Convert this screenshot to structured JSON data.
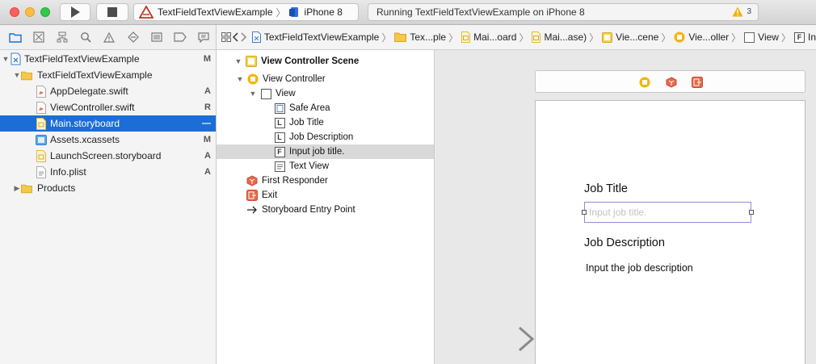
{
  "toolbar": {
    "scheme_project": "TextFieldTextViewExample",
    "scheme_device": "iPhone 8",
    "activity_status": "Running TextFieldTextViewExample on iPhone 8",
    "warning_count": "3"
  },
  "navigator": {
    "tabs": [
      "folder-icon",
      "source-control-icon",
      "hierarchy-icon",
      "search-icon",
      "warning-icon",
      "test-icon",
      "debug-icon",
      "breakpoint-icon",
      "report-icon"
    ],
    "items": [
      {
        "label": "TextFieldTextViewExample",
        "status": "M",
        "icon": "project-icon",
        "depth": 0,
        "expanded": true
      },
      {
        "label": "TextFieldTextViewExample",
        "status": "",
        "icon": "folder-icon",
        "depth": 1,
        "expanded": true
      },
      {
        "label": "AppDelegate.swift",
        "status": "A",
        "icon": "swift-file-icon",
        "depth": 2
      },
      {
        "label": "ViewController.swift",
        "status": "R",
        "icon": "swift-file-icon",
        "depth": 2
      },
      {
        "label": "Main.storyboard",
        "status": "—",
        "icon": "storyboard-icon",
        "depth": 2,
        "selected": true
      },
      {
        "label": "Assets.xcassets",
        "status": "M",
        "icon": "assets-icon",
        "depth": 2
      },
      {
        "label": "LaunchScreen.storyboard",
        "status": "A",
        "icon": "storyboard-icon",
        "depth": 2
      },
      {
        "label": "Info.plist",
        "status": "A",
        "icon": "plist-icon",
        "depth": 2
      },
      {
        "label": "Products",
        "status": "",
        "icon": "folder-icon",
        "depth": 1,
        "expanded": false
      }
    ]
  },
  "jumpbar": {
    "crumbs": [
      "TextFieldTextViewExample",
      "Tex...ple",
      "Mai...oard",
      "Mai...ase)",
      "Vie...cene",
      "Vie...oller",
      "View",
      "In"
    ]
  },
  "outline": {
    "items": [
      {
        "label": "View Controller Scene",
        "icon": "scene-icon",
        "bold": true
      },
      {
        "label": "View Controller",
        "icon": "view-controller-icon"
      },
      {
        "label": "View",
        "icon": "view-icon"
      },
      {
        "label": "Safe Area",
        "icon": "safe-area-icon"
      },
      {
        "label": "Job Title",
        "icon": "label-icon",
        "glyph": "L"
      },
      {
        "label": "Job Description",
        "icon": "label-icon",
        "glyph": "L"
      },
      {
        "label": "Input job title.",
        "icon": "text-field-icon",
        "glyph": "F",
        "selected": true
      },
      {
        "label": "Text View",
        "icon": "text-view-icon"
      },
      {
        "label": "First Responder",
        "icon": "first-responder-icon"
      },
      {
        "label": "Exit",
        "icon": "exit-icon"
      },
      {
        "label": "Storyboard Entry Point",
        "icon": "entry-point-icon"
      }
    ]
  },
  "canvas": {
    "job_title_label": "Job Title",
    "text_field_placeholder": "Input job title.",
    "job_description_label": "Job Description",
    "text_view_text": "Input the job description"
  },
  "colors": {
    "selection": "#1a6ed5",
    "folder": "#f3c84b",
    "swift": "#e8644a",
    "text_field_border": "#8e8ae0"
  }
}
